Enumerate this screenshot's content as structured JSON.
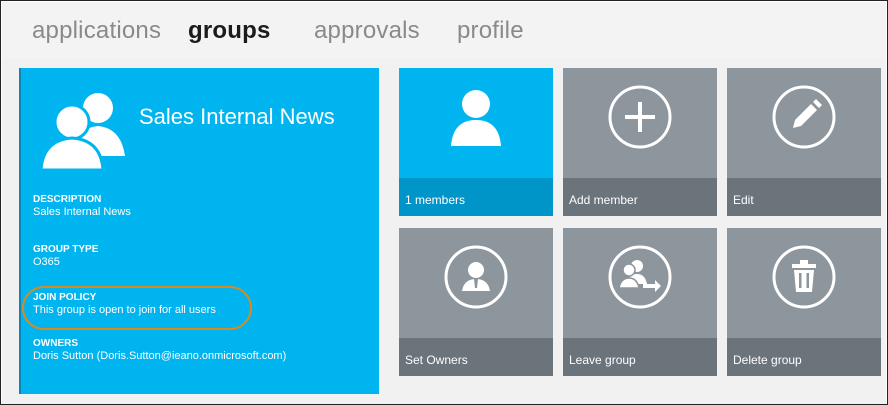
{
  "nav": {
    "tabs": [
      {
        "label": "applications",
        "active": false
      },
      {
        "label": "groups",
        "active": true
      },
      {
        "label": "approvals",
        "active": false
      },
      {
        "label": "profile",
        "active": false
      }
    ]
  },
  "group": {
    "title": "Sales Internal News",
    "avatar_icon": "group-people-icon",
    "fields": [
      {
        "label": "DESCRIPTION",
        "value": "Sales Internal News"
      },
      {
        "label": "GROUP TYPE",
        "value": "O365"
      },
      {
        "label": "JOIN POLICY",
        "value": "This group is open to join for all users"
      },
      {
        "label": "OWNERS",
        "value": "Doris Sutton (Doris.Sutton@ieano.onmicrosoft.com)"
      }
    ]
  },
  "tiles": [
    {
      "label": "1 members",
      "icon": "person-icon"
    },
    {
      "label": "Add member",
      "icon": "plus-circle-icon"
    },
    {
      "label": "Edit",
      "icon": "pencil-circle-icon"
    },
    {
      "label": "Set Owners",
      "icon": "owner-circle-icon"
    },
    {
      "label": "Leave group",
      "icon": "leave-group-circle-icon"
    },
    {
      "label": "Delete group",
      "icon": "trash-circle-icon"
    }
  ],
  "colors": {
    "accent": "#00b4ef",
    "tile_gray": "#8d959d",
    "highlight": "#d98a1f"
  }
}
